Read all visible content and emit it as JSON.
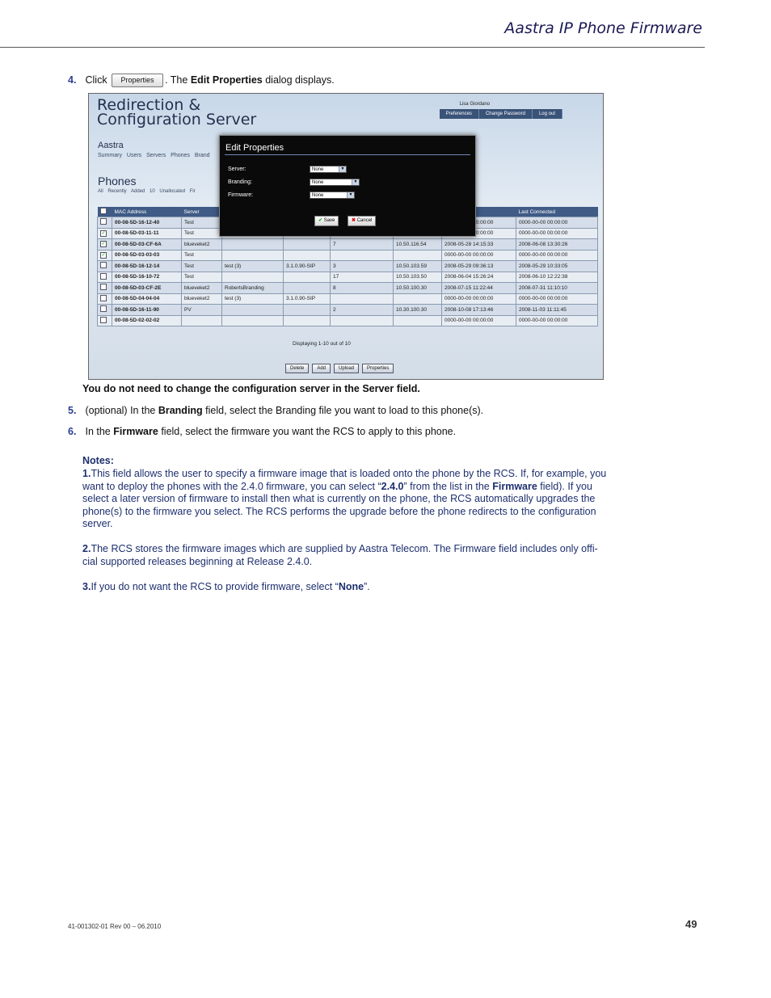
{
  "header": {
    "title": "Aastra IP Phone Firmware"
  },
  "step4": {
    "num": "4.",
    "pre": "Click",
    "btn": "Properties",
    "mid": ". The",
    "bold": "Edit Properties",
    "post": "dialog displays."
  },
  "shot": {
    "title_line1": "Redirection &",
    "title_line2": "Configuration Server",
    "user": "Lisa Giordano",
    "topnav": [
      "Preferences",
      "Change Password",
      "Log out"
    ],
    "aastra": "Aastra",
    "subnav1": "Summary  Users  Servers  Phones  Brand",
    "phones": "Phones",
    "subnav2": "All  Recently Added 10  Unallocated  Fir",
    "columns": [
      "",
      "MAC Address",
      "Server",
      "",
      "",
      "",
      "",
      "Registered",
      "Last Connected"
    ],
    "rows": [
      {
        "check": "",
        "mac": "00-08-5D-16-12-40",
        "server": "Test",
        "brand": "",
        "fw": "",
        "ext": "",
        "ip": "",
        "reg": "0000-00-00 00:00:00",
        "last": "0000-00-00 00:00:00"
      },
      {
        "check": "✓",
        "mac": "00-08-5D-03-11-11",
        "server": "Test",
        "brand": "",
        "fw": "",
        "ext": "",
        "ip": "",
        "reg": "0000-00-00 00:00:00",
        "last": "0000-00-00 00:00:00"
      },
      {
        "check": "✓",
        "mac": "00-08-5D-03-CF-6A",
        "server": "blueveket2",
        "brand": "",
        "fw": "",
        "ext": "7",
        "ip": "10.50.116.54",
        "reg": "2008-05-28 14:15:33",
        "last": "2008-06-08 13:30:26"
      },
      {
        "check": "✓",
        "mac": "00-08-5D-03-03-03",
        "server": "Test",
        "brand": "",
        "fw": "",
        "ext": "",
        "ip": "",
        "reg": "0000-00-00 00:00:00",
        "last": "0000-00-00 00:00:00"
      },
      {
        "check": "",
        "mac": "00-08-5D-16-12-14",
        "server": "Test",
        "brand": "test (3)",
        "fw": "3.1.0.90-SIP",
        "ext": "3",
        "ip": "10.50.103.59",
        "reg": "2008-05-29 09:36:13",
        "last": "2008-05-29 10:33:05"
      },
      {
        "check": "",
        "mac": "00-08-5D-16-10-72",
        "server": "Test",
        "brand": "",
        "fw": "",
        "ext": "17",
        "ip": "10.50.103.50",
        "reg": "2008-06-04 15:26:24",
        "last": "2008-06-10 12:22:38"
      },
      {
        "check": "",
        "mac": "00-08-5D-03-CF-2E",
        "server": "blueveket2",
        "brand": "RobertsBranding",
        "fw": "",
        "ext": "8",
        "ip": "10.50.100.30",
        "reg": "2008-07-15 11:22:44",
        "last": "2008-07-31 11:10:10"
      },
      {
        "check": "",
        "mac": "00-08-5D-04-04-04",
        "server": "blueveket2",
        "brand": "test (3)",
        "fw": "3.1.0.90-SIP",
        "ext": "",
        "ip": "",
        "reg": "0000-00-00 00:00:00",
        "last": "0000-00-00 00:00:00"
      },
      {
        "check": "",
        "mac": "00-08-5D-16-11-90",
        "server": "PV",
        "brand": "",
        "fw": "",
        "ext": "2",
        "ip": "10.30.100.30",
        "reg": "2008-10-08 17:13:46",
        "last": "2008-11-03 11:11:45"
      },
      {
        "check": "",
        "mac": "00-08-5D-02-02-02",
        "server": "",
        "brand": "",
        "fw": "",
        "ext": "",
        "ip": "",
        "reg": "0000-00-00 00:00:00",
        "last": "0000-00-00 00:00:00"
      }
    ],
    "displaying": "Displaying 1-10 out of 10",
    "bottom_buttons": [
      "Delete",
      "Add",
      "Upload",
      "Properties"
    ],
    "dialog": {
      "title": "Edit Properties",
      "server_label": "Server:",
      "server_value": "None",
      "branding_label": "Branding:",
      "branding_value": "None",
      "firmware_label": "Firmware:",
      "firmware_value": "None",
      "save": "Save",
      "cancel": "Cancel"
    }
  },
  "note_bold": "You do not need to change the configuration server in the Server field.",
  "step5": {
    "num": "5.",
    "pre": "(optional) In the",
    "bold": "Branding",
    "post": "field, select the Branding file you want to load to this phone(s)."
  },
  "step6": {
    "num": "6.",
    "pre": "In the",
    "bold": "Firmware",
    "post": "field, select the firmware you want the RCS to apply to this phone."
  },
  "notes": {
    "heading": "Notes:",
    "n1_num": "1.",
    "n1_a": "This field allows the user to specify a firmware image that is loaded onto the phone by the RCS.  If, for example, you want to deploy the phones with the 2.4.0 firmware, you can select “",
    "n1_b": "2.4.0",
    "n1_c": "” from the list in the ",
    "n1_d": "Firmware",
    "n1_e": " field). If you select a later version of firmware to install then what is currently on the phone, the RCS automatically upgrades the phone(s) to the firmware you select. The RCS performs the upgrade before the phone redirects to the configuration server.",
    "n2_num": "2.",
    "n2_a": "The RCS stores the firmware images which are supplied by Aastra Telecom. The Firmware field includes only offi-cial supported releases beginning at Release 2.4.0.",
    "n3_num": "3.",
    "n3_a": "If you do not want the RCS to provide firmware, select “",
    "n3_b": "None",
    "n3_c": "”."
  },
  "footer": {
    "doc": "41-001302-01 Rev 00 – 06.2010",
    "page": "49"
  }
}
